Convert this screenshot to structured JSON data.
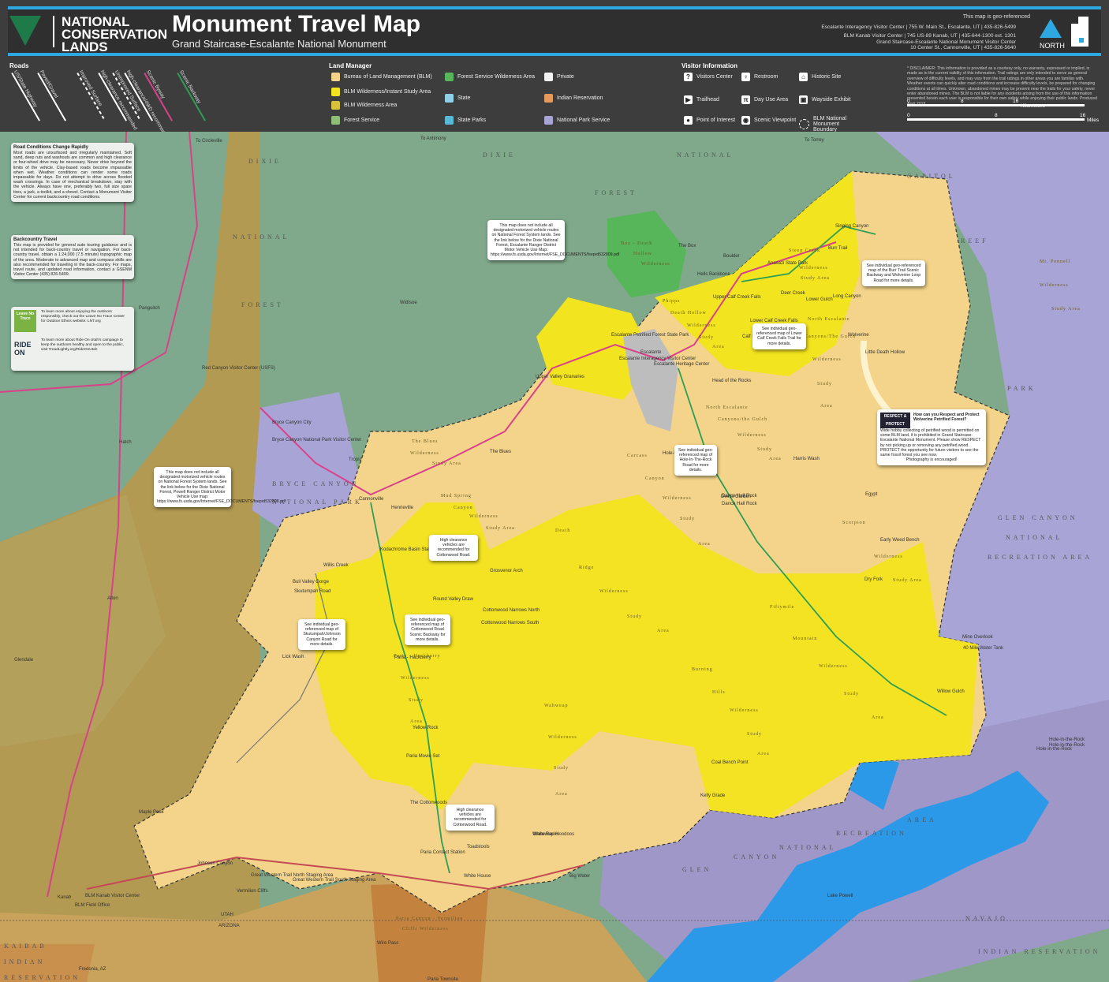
{
  "header": {
    "org_logo": "NATIONAL CONSERVATION LANDS",
    "title": "Monument Travel Map",
    "subtitle": "Grand Staircase-Escalante National Monument",
    "geo_note": "This map is geo-referenced",
    "visitor_centers": [
      "Escalante Interagency Visitor Center | 755 W. Main St., Escalante, UT | 435-826-5499",
      "BLM Kanab Visitor Center | 745 US-89 Kanab, UT | 435-644-1300 ext. 1301",
      "Grand Staircase-Escalante National Monument Visitor Center",
      "10 Center St., Cannonville, UT | 435-826-5640"
    ],
    "north_label": "NORTH"
  },
  "legend": {
    "roads_label": "Roads",
    "roads": [
      {
        "label": "US/State Highway",
        "color": "#ffffff"
      },
      {
        "label": "Paved/Gravel",
        "color": "#ffffff"
      },
      {
        "label": "Improved Surface",
        "color": "#ffffff"
      },
      {
        "label": "high-clearance recommended",
        "color": "#ffffff"
      },
      {
        "label": "Unimproved Surface",
        "color": "#ffffff"
      },
      {
        "label": "high-clearance/4WD recommended",
        "color": "#ffffff"
      },
      {
        "label": "Scenic Byway",
        "color": "#d9428a"
      },
      {
        "label": "Scenic Backway",
        "color": "#2e9e55"
      }
    ],
    "land_manager_label": "Land Manager",
    "land_managers": [
      {
        "label": "Bureau of Land Management (BLM)",
        "color": "#f3d48a"
      },
      {
        "label": "BLM Wilderness/Instant Study Area",
        "color": "#f2e41e"
      },
      {
        "label": "BLM Wilderness Area",
        "color": "#d9c23b"
      },
      {
        "label": "Forest Service",
        "color": "#8fbf76"
      },
      {
        "label": "Forest Service Wilderness Area",
        "color": "#57b55a"
      },
      {
        "label": "State",
        "color": "#8fd0e8"
      },
      {
        "label": "State Parks",
        "color": "#56b9d6"
      },
      {
        "label": "Private",
        "color": "#f2f2f2"
      },
      {
        "label": "Indian Reservation",
        "color": "#e59a5d"
      },
      {
        "label": "National Park Service",
        "color": "#a8a4d6"
      }
    ],
    "visitor_info_label": "Visitor Information",
    "visitor_info": [
      {
        "label": "Visitors Center",
        "icon": "?"
      },
      {
        "label": "Trailhead",
        "icon": "▶"
      },
      {
        "label": "Point of Interest",
        "icon": "●"
      },
      {
        "label": "Restroom",
        "icon": "♀"
      },
      {
        "label": "Day Use Area",
        "icon": "π"
      },
      {
        "label": "Scenic Viewpoint",
        "icon": "◉"
      },
      {
        "label": "Historic Site",
        "icon": "⌂"
      },
      {
        "label": "Wayside Exhibit",
        "icon": "▣"
      },
      {
        "label": "BLM National Monument Boundary",
        "icon": "boundary"
      }
    ],
    "disclaimer": "* DISCLAIMER: This information is provided as a courtesy only, no warranty, expressed or implied, is made as to the current validity of this information. Trail ratings are only intended to serve as general overview of difficulty levels, and may vary from the trail ratings in other areas you are familiar with. Weather events can quickly alter road conditions and increase difficulty levels, be prepared for changing conditions at all times. Unknown, abandoned mines may be present near the trails for your safety, never enter abandoned mines. The BLM is not liable for any incidents arising from the use of this information presented herein each user is responsible for their own safety while enjoying their public lands. Produced April 2019.",
    "scale": {
      "km_ticks": [
        "0",
        "8",
        "16"
      ],
      "km_label": "Kilometers",
      "mi_ticks": [
        "0",
        "8",
        "16"
      ],
      "mi_label": "Miles"
    }
  },
  "info_boxes": {
    "road_conditions": {
      "title": "Road Conditions Change Rapidly",
      "body": "Most roads are unsurfaced and irregularly maintained. Soft sand, deep ruts and washouts are common and high clearance or four-wheel drive may be necessary. Never drive beyond the limits of the vehicle. Clay-based roads become impassable when wet. Weather conditions can render some roads impassable for days. Do not attempt to drive across flooded wash crossings. In case of mechanical breakdown, stay with the vehicle. Always have one, preferably two, full size spare tires, a jack, a toolkit, and a shovel. Contact a Monument Visitor Center for current backcountry road conditions."
    },
    "backcountry": {
      "title": "Backcountry Travel",
      "body": "This map is provided for general auto touring guidance and is not intended for back-country travel or navigation. For back-country travel, obtain a 1:24,000 (7.5 minute) topographic map of the area. Moderate to advanced map and compass skills are also recommended for traveling in the back-country. For maps, travel route, and updated road information, contact a GSENM Visitor Center (435) 826-5499."
    },
    "leave_no_trace": {
      "logo": "Leave No Trace",
      "text": "To learn more about enjoying the outdoors responsibly, check out the Leave No Trace Center for Outdoor Ethics website: LNT.org"
    },
    "ride_on": {
      "logo": "RIDE ON",
      "text": "To learn more about Ride On Utah's campaign to keep the outdoors healthy and open to the public, visit TreadLightly.org/RideOnUtah"
    }
  },
  "map_notes": {
    "fs_note_north": "This map does not include all designated motorized vehicle routes on National Forest System lands. See the link below for the Dixie National Forest, Escalante Ranger District Motor Vehicle Use Map: https://www.fs.usda.gov/Internet/FSE_DOCUMENTS/fseprd532809.pdf",
    "fs_note_west": "This map does not include all designated motorized vehicle routes on National Forest System lands. See the link below for the Dixie National Forest, Powell Ranger District Motor Vehicle Use map: https://www.fs.usda.gov/Internet/FSE_DOCUMENTS/fseprd532808.pdf",
    "burr_trail": "See individual geo-referenced map of the Burr Trail Scenic Backway and Wolverine Loop Road for more details.",
    "lower_calf_creek": "See individual geo-referenced map of Lower Calf Creek Falls Trail for more details.",
    "hole_in_the_rock": "See individual geo-referenced map of Hole-In-The-Rock Road for more details.",
    "skutumpah": "See individual geo-referenced map of Skutumpah/Johnson Canyon Road for more details.",
    "cottonwood": "See individual geo-referenced map of Cottonwood Road Scenic Backway for more details.",
    "high_clearance_1": "High clearance vehicles are recommended for Cottonwood Road.",
    "high_clearance_2": "High clearance vehicles are recommended for Cottonwood Road.",
    "respect": {
      "logo": "RESPECT & PROTECT",
      "title": "How can you Respect and Protect Wolverine Petrified Forest?",
      "body": "Wide hobby collecting of petrified wood is permitted on some BLM land, it is prohibited in Grand Staircase-Escalante National Monument. Please show RESPECT by not picking up or removing any petrified wood. PROTECT the opportunity for future visitors to see the same fossil forest you see now.",
      "footer": "Photography is encouraged!"
    }
  },
  "regions": [
    {
      "id": "dixie-nf-w",
      "text": "DIXIE"
    },
    {
      "id": "national-w",
      "text": "NATIONAL"
    },
    {
      "id": "forest-w",
      "text": "FOREST"
    },
    {
      "id": "dixie-nf-n",
      "text": "DIXIE"
    },
    {
      "id": "national-n",
      "text": "NATIONAL"
    },
    {
      "id": "forest-n",
      "text": "FOREST"
    },
    {
      "id": "capitol",
      "text": "CAPITOL"
    },
    {
      "id": "reef",
      "text": "REEF"
    },
    {
      "id": "park",
      "text": "PARK"
    },
    {
      "id": "glen-canyon",
      "text": "GLEN CANYON"
    },
    {
      "id": "glen-national",
      "text": "NATIONAL"
    },
    {
      "id": "recreation-area",
      "text": "RECREATION AREA"
    },
    {
      "id": "bryce",
      "text": "BRYCE CANYON"
    },
    {
      "id": "bryce-np",
      "text": "NATIONAL PARK"
    },
    {
      "id": "navajo",
      "text": "NAVAJO"
    },
    {
      "id": "indian-res",
      "text": "INDIAN RESERVATION"
    },
    {
      "id": "kaibab",
      "text": "KAIBAB"
    },
    {
      "id": "indian",
      "text": "INDIAN"
    },
    {
      "id": "reservation",
      "text": "RESERVATION"
    },
    {
      "id": "canyon-s",
      "text": "CANYON"
    },
    {
      "id": "national-s",
      "text": "NATIONAL"
    },
    {
      "id": "recreation-s",
      "text": "RECREATION"
    },
    {
      "id": "area-s",
      "text": "AREA"
    },
    {
      "id": "glen-s",
      "text": "GLEN"
    }
  ],
  "wilderness_labels": [
    "Box - Death",
    "Hollow",
    "Wilderness",
    "Steep Creek",
    "Wilderness",
    "Study Area",
    "Phipps",
    "Death Hollow",
    "Wilderness",
    "Study",
    "Area",
    "North Escalante",
    "Canyons/The Gulch",
    "Wilderness",
    "Study",
    "Area",
    "North Escalante",
    "Canyons/the Gulch",
    "Wilderness",
    "Study",
    "Area",
    "Carcass",
    "Canyon",
    "Wilderness",
    "Study",
    "Area",
    "Scorpion",
    "Wilderness",
    "Study Area",
    "Fiftymile",
    "Mountain",
    "Wilderness",
    "Study",
    "Area",
    "Death",
    "Ridge",
    "Wilderness",
    "Study",
    "Area",
    "Burning",
    "Hills",
    "Wilderness",
    "Study",
    "Area",
    "Mud Spring",
    "Canyon",
    "Wilderness",
    "Study Area",
    "The Blues",
    "Wilderness",
    "Study Area",
    "Paria - Hackberry",
    "Wilderness",
    "Study",
    "Area",
    "Wahweap",
    "Wilderness",
    "Study",
    "Area",
    "Paria Canyon - Vermilion",
    "Cliffs Wilderness",
    "Mt. Pennell",
    "Wilderness",
    "Study Area"
  ],
  "places": [
    {
      "id": "to-circleville",
      "text": "To Circleville"
    },
    {
      "id": "to-antimony",
      "text": "To Antimony"
    },
    {
      "id": "to-torrey",
      "text": "To Torrey"
    },
    {
      "id": "panguitch",
      "text": "Panguitch"
    },
    {
      "id": "wolvee",
      "text": "Widtsoe"
    },
    {
      "id": "escalante",
      "text": "Escalante"
    },
    {
      "id": "boulder",
      "text": "Boulder"
    },
    {
      "id": "bryce-canyon-city",
      "text": "Bryce Canyon City"
    },
    {
      "id": "tropic",
      "text": "Tropic"
    },
    {
      "id": "cannonville",
      "text": "Cannonville"
    },
    {
      "id": "henrieville",
      "text": "Henrieville"
    },
    {
      "id": "hatch",
      "text": "Hatch"
    },
    {
      "id": "alton",
      "text": "Alton"
    },
    {
      "id": "glendale",
      "text": "Glendale"
    },
    {
      "id": "kanab",
      "text": "Kanab"
    },
    {
      "id": "big-water",
      "text": "Big Water"
    },
    {
      "id": "fredonia",
      "text": "Fredonia, AZ"
    },
    {
      "id": "utah",
      "text": "UTAH"
    },
    {
      "id": "arizona",
      "text": "ARIZONA"
    },
    {
      "id": "lake-powell",
      "text": "Lake Powell"
    },
    {
      "id": "skutumpah-road",
      "text": "Skutumpah Road"
    },
    {
      "id": "paria-contact",
      "text": "Paria Contact Station"
    },
    {
      "id": "blm-kanab",
      "text": "BLM Kanab Visitor Center"
    },
    {
      "id": "blm-field",
      "text": "BLM Field Office"
    },
    {
      "id": "escalante-vc",
      "text": "Escalante Interagency Visitor Center"
    },
    {
      "id": "kodachrome",
      "text": "Kodachrome Basin State Park"
    },
    {
      "id": "grosvenor",
      "text": "Grosvenor Arch"
    },
    {
      "id": "dance-hall",
      "text": "Dance Hall Rock"
    },
    {
      "id": "hole-in-the-rock",
      "text": "Hole-in-the-Rock"
    },
    {
      "id": "calf-creek",
      "text": "Calf Creek Recreation Area"
    },
    {
      "id": "lower-calf",
      "text": "Lower Calf Creek Falls"
    },
    {
      "id": "anasazi",
      "text": "Anasazi State Park"
    },
    {
      "id": "red-canyon",
      "text": "Red Canyon Visitor Center (USFS)"
    },
    {
      "id": "bryce-vc",
      "text": "Bryce Canyon National Park Visitor Center"
    },
    {
      "id": "great-western-n",
      "text": "Great Western Trail North Staging Area"
    },
    {
      "id": "great-western-s",
      "text": "Great Western Trail South Staging Area"
    },
    {
      "id": "paria-townsite",
      "text": "Paria Townsite"
    },
    {
      "id": "white-house",
      "text": "White House"
    },
    {
      "id": "toadstools",
      "text": "Toadstools"
    },
    {
      "id": "wire-pass",
      "text": "Wire Pass"
    },
    {
      "id": "lick-wash",
      "text": "Lick Wash"
    },
    {
      "id": "willis-creek",
      "text": "Willis Creek"
    },
    {
      "id": "bull-valley",
      "text": "Bull Valley Gorge"
    },
    {
      "id": "round-valley",
      "text": "Round Valley Draw"
    },
    {
      "id": "cottonwood-narrows-n",
      "text": "Cottonwood Narrows North"
    },
    {
      "id": "cottonwood-narrows-s",
      "text": "Cottonwood Narrows South"
    },
    {
      "id": "yellow-rock",
      "text": "Yellow Rock"
    },
    {
      "id": "paria-movie",
      "text": "Paria Movie Set"
    },
    {
      "id": "kelly-grade",
      "text": "Kelly Grade"
    },
    {
      "id": "coal-bench",
      "text": "Coal Bench Point"
    },
    {
      "id": "devils-garden",
      "text": "Devils Garden"
    },
    {
      "id": "harris-wash",
      "text": "Harris Wash"
    },
    {
      "id": "egypt",
      "text": "Egypt"
    },
    {
      "id": "early-weed",
      "text": "Early Weed Bench"
    },
    {
      "id": "dry-fork",
      "text": "Dry Fork"
    },
    {
      "id": "40-mile",
      "text": "40 Mile Water Tank"
    },
    {
      "id": "dance-hall-2",
      "text": "Dance Hall Rock"
    },
    {
      "id": "willow-gulch",
      "text": "Willow Gulch"
    },
    {
      "id": "hole-rock-2",
      "text": "Hole-in-the-Rock"
    },
    {
      "id": "head-rocks",
      "text": "Head of the Rocks"
    },
    {
      "id": "hole-in-rock-road",
      "text": "Hole-in-the-Rock Road"
    },
    {
      "id": "burr-trail",
      "text": "Burr Trail"
    },
    {
      "id": "deer-creek",
      "text": "Deer Creek"
    },
    {
      "id": "lower-gulch",
      "text": "Lower Gulch"
    },
    {
      "id": "long-canyon",
      "text": "Long Canyon"
    },
    {
      "id": "wolverine",
      "text": "Wolverine"
    },
    {
      "id": "little-death",
      "text": "Little Death Hollow"
    },
    {
      "id": "hells-backbone",
      "text": "Hells Backbone"
    },
    {
      "id": "upper-valley",
      "text": "Upper Valley Granaries"
    },
    {
      "id": "escalante-heritage",
      "text": "Escalante Heritage Center"
    },
    {
      "id": "escalante-petrified",
      "text": "Escalante Petrified Forest State Park"
    },
    {
      "id": "upper-calf",
      "text": "Upper Calf Creek Falls"
    },
    {
      "id": "singing-canyon",
      "text": "Singing Canyon"
    },
    {
      "id": "hole-rock-3",
      "text": "Hole-in-the-Rock"
    },
    {
      "id": "the-box",
      "text": "The Box"
    },
    {
      "id": "johnson-canyon",
      "text": "Johnson Canyon"
    },
    {
      "id": "vermilion",
      "text": "Vermilion Cliffs"
    },
    {
      "id": "mine-overlook",
      "text": "Mine Overlook"
    },
    {
      "id": "the-cottonwoods",
      "text": "The Cottonwoods"
    },
    {
      "id": "wahweap-hoodoos",
      "text": "Wahweap Hoodoos"
    },
    {
      "id": "white-rocks",
      "text": "White Rocks"
    },
    {
      "id": "the-blues",
      "text": "The Blues"
    },
    {
      "id": "paria-hackberry",
      "text": "Paria - Hackberry"
    },
    {
      "id": "maple-peak",
      "text": "Maple Peak"
    }
  ],
  "colors": {
    "blm": "#f3d48a",
    "wsa": "#f2e41e",
    "forest": "#8fbf76",
    "forest_wild": "#57b55a",
    "nps": "#a8a4d6",
    "water": "#2b98e8",
    "indian": "#c48a46",
    "private": "#ececec",
    "state": "#8fd0e8"
  }
}
